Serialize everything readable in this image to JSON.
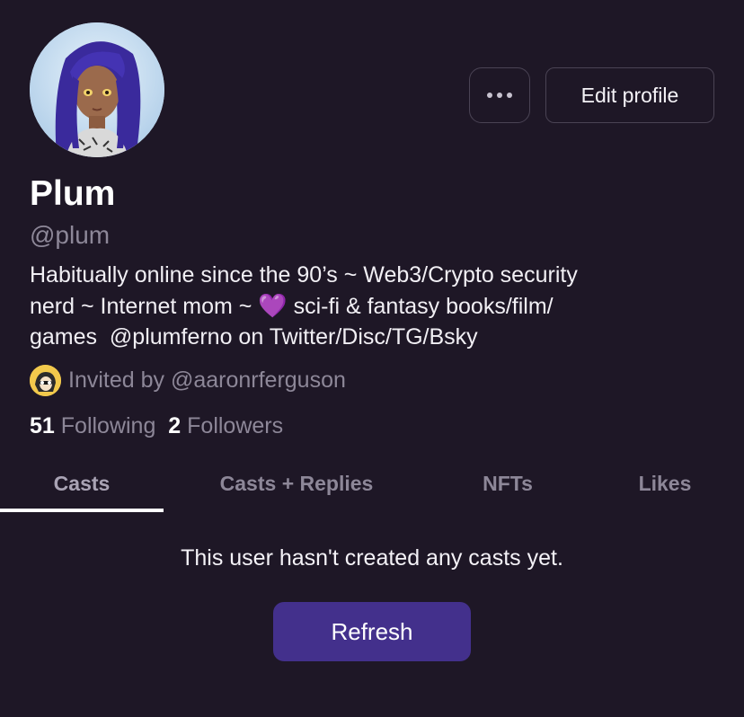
{
  "profile": {
    "display_name": "Plum",
    "username": "@plum",
    "bio_lines": [
      "Habitually online since the 90’s ~ Web3/Crypto security",
      "nerd ~ Internet mom ~ ",
      "games  @plumferno on Twitter/Disc/TG/Bsky"
    ],
    "bio_heart": "💜",
    "bio_line2_rest": " sci-fi & fantasy books/film/",
    "invited_by": "Invited by @aaronrferguson",
    "following_count": "51",
    "following_label": "Following",
    "followers_count": "2",
    "followers_label": "Followers"
  },
  "actions": {
    "more_icon": "more-horizontal-icon",
    "edit_profile_label": "Edit profile"
  },
  "tabs": [
    {
      "label": "Casts",
      "active": true
    },
    {
      "label": "Casts + Replies",
      "active": false
    },
    {
      "label": "NFTs",
      "active": false
    },
    {
      "label": "Likes",
      "active": false
    }
  ],
  "feed": {
    "empty_message": "This user hasn't created any casts yet.",
    "refresh_label": "Refresh"
  },
  "colors": {
    "background": "#1e1726",
    "muted_text": "#8d8798",
    "accent_button": "#43308c",
    "heart": "#9b4bff"
  }
}
